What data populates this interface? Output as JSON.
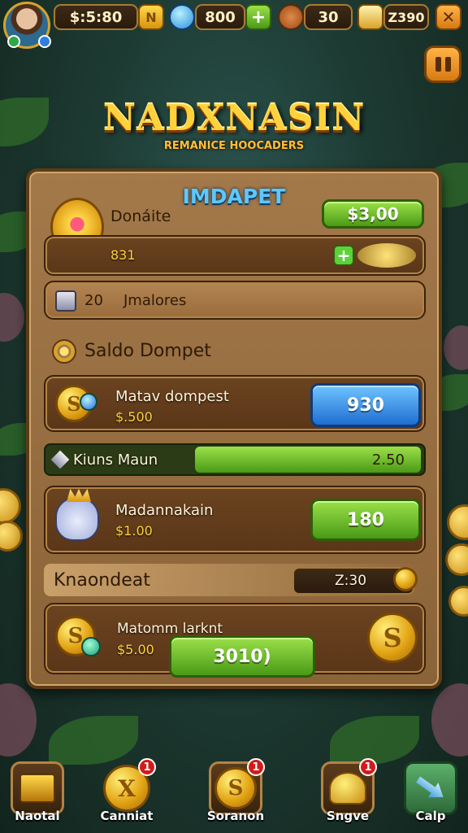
{
  "topbar": {
    "gold": "$:5:80",
    "gold_badge": "N",
    "gems": "800",
    "wood": "30",
    "chests": "Z390",
    "close_symbol": "✕"
  },
  "title": {
    "main": "NADXNASIN",
    "sub": "REMANICE HOOCADERS"
  },
  "panel": {
    "heading": "IMDAPET",
    "donate": {
      "label": "Donáite",
      "value": "$3,00",
      "sub": "831"
    },
    "notice": {
      "count": "20",
      "text": "Jmalores"
    },
    "section1": "Saldo Dompet",
    "row1": {
      "title": "Matav dompest",
      "amount": "$.500",
      "button": "930"
    },
    "bar": {
      "label": "Kiuns Maun",
      "value": "2.50",
      "fill_percent": 100
    },
    "row2": {
      "title": "Madannakain",
      "amount": "$1.00",
      "button": "180"
    },
    "section2": {
      "label": "Knaondeat",
      "value": "Z:30"
    },
    "row3": {
      "title": "Matomm larknt",
      "amount": "$5.00",
      "button": "3010)"
    }
  },
  "nav": [
    {
      "label": "Naotal",
      "badge": ""
    },
    {
      "label": "Canniat",
      "badge": "1"
    },
    {
      "label": "Soranon",
      "badge": "1"
    },
    {
      "label": "Sngve",
      "badge": "1"
    },
    {
      "label": "Calp",
      "badge": ""
    }
  ],
  "colors": {
    "accent_gold": "#ffd23c",
    "button_green": "#4a9a16",
    "button_blue": "#1f6ed1",
    "heading_blue": "#5cc8ff",
    "badge_red": "#d21b1b"
  }
}
